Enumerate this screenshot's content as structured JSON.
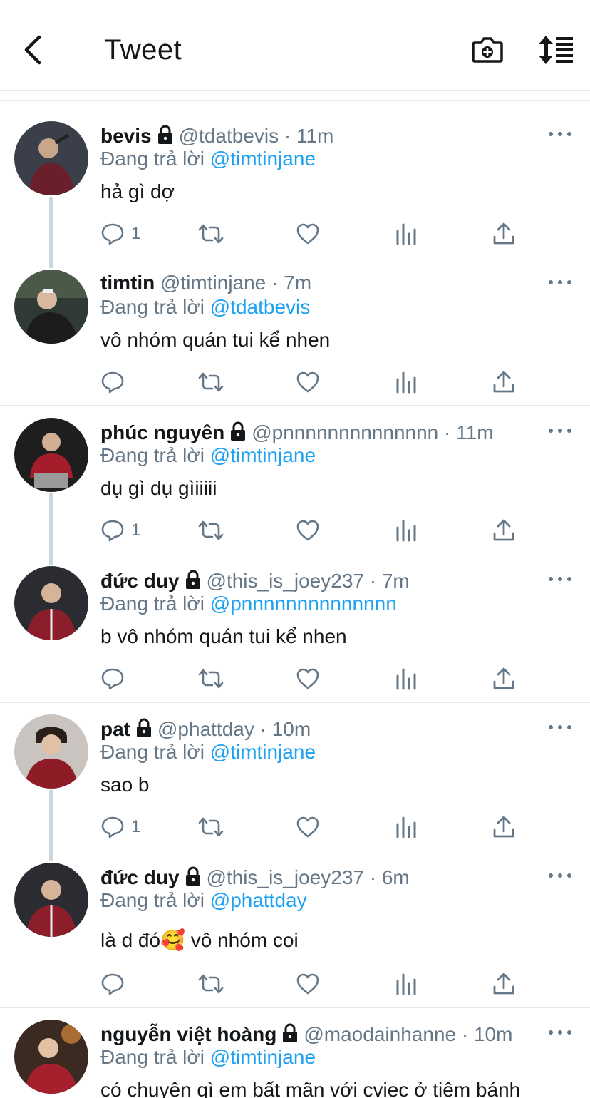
{
  "header": {
    "title": "Tweet"
  },
  "tweets": [
    {
      "name": "bevis",
      "protected": true,
      "handle": "@tdatbevis",
      "time": "· 11m",
      "reply_prefix": "Đang trả lời",
      "reply_to": "@timtinjane",
      "text": "hả gì dợ",
      "reply_count": "1"
    },
    {
      "name": "timtin",
      "protected": false,
      "handle": "@timtinjane",
      "time": "· 7m",
      "reply_prefix": "Đang trả lời",
      "reply_to": "@tdatbevis",
      "text": "vô nhóm quán tui kể nhen",
      "reply_count": ""
    },
    {
      "name": "phúc nguyên",
      "protected": true,
      "handle": "@pnnnnnnnnnnnnnn",
      "time": "· 11m",
      "reply_prefix": "Đang trả lời",
      "reply_to": "@timtinjane",
      "text": "dụ gì dụ gìiiiii",
      "reply_count": "1"
    },
    {
      "name": "đức duy",
      "protected": true,
      "handle": "@this_is_joey237",
      "time": "· 7m",
      "reply_prefix": "Đang trả lời",
      "reply_to": "@pnnnnnnnnnnnnnn",
      "text": "b vô nhóm quán tui kể nhen",
      "reply_count": ""
    },
    {
      "name": "pat",
      "protected": true,
      "handle": "@phattday",
      "time": "· 10m",
      "reply_prefix": "Đang trả lời",
      "reply_to": "@timtinjane",
      "text": "sao b",
      "reply_count": "1"
    },
    {
      "name": "đức duy",
      "protected": true,
      "handle": "@this_is_joey237",
      "time": "· 6m",
      "reply_prefix": "Đang trả lời",
      "reply_to": "@phattday",
      "text": "là d đó🥰  vô nhóm coi",
      "reply_count": ""
    },
    {
      "name": "nguyễn việt hoàng",
      "protected": true,
      "handle": "@maodainhanne",
      "time": "· 10m",
      "reply_prefix": "Đang trả lời",
      "reply_to": "@timtinjane",
      "text": "có chuyện gì em bất mãn với cviec ở tiệm bánh",
      "reply_count": ""
    }
  ],
  "colors": {
    "accent": "#1da1f2",
    "secondary_text": "#657786",
    "divider": "#e1e8ed"
  }
}
